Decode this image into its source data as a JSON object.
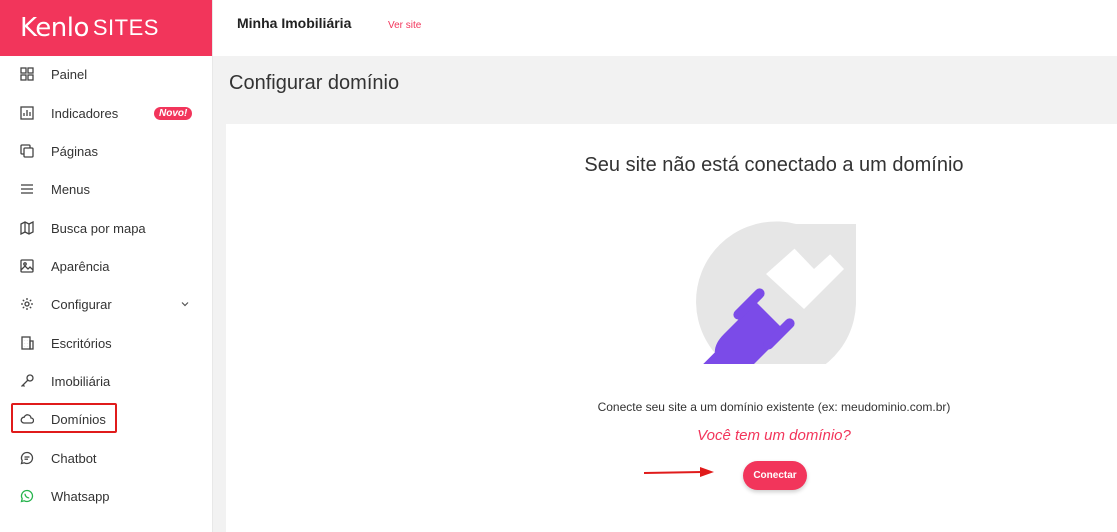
{
  "brand": {
    "logo_main": "Kenlo",
    "logo_sub": "SITES",
    "color": "#f2355b"
  },
  "topbar": {
    "site_name": "Minha Imobiliária",
    "ver_site": "Ver site"
  },
  "sidebar": {
    "items": [
      {
        "label": "Painel",
        "icon": "grid-icon"
      },
      {
        "label": "Indicadores",
        "icon": "chart-icon",
        "badge": "Novo!"
      },
      {
        "label": "Páginas",
        "icon": "pages-icon"
      },
      {
        "label": "Menus",
        "icon": "menu-icon"
      },
      {
        "label": "Busca por mapa",
        "icon": "map-icon"
      },
      {
        "label": "Aparência",
        "icon": "image-icon"
      },
      {
        "label": "Configurar",
        "icon": "gear-icon",
        "has_submenu": true
      },
      {
        "label": "Escritórios",
        "icon": "building-icon"
      },
      {
        "label": "Imobiliária",
        "icon": "key-icon"
      },
      {
        "label": "Domínios",
        "icon": "cloud-icon",
        "highlighted": true
      },
      {
        "label": "Chatbot",
        "icon": "chat-icon"
      },
      {
        "label": "Whatsapp",
        "icon": "whatsapp-icon"
      }
    ]
  },
  "page": {
    "title": "Configurar domínio",
    "heading": "Seu site não está conectado a um domínio",
    "description": "Conecte seu site a um domínio existente (ex: meudominio.com.br)",
    "question": "Você tem um domínio?",
    "connect_label": "Conectar"
  },
  "colors": {
    "accent": "#f2355b",
    "plug": "#7b4be8",
    "annotation": "#e01b1b"
  }
}
